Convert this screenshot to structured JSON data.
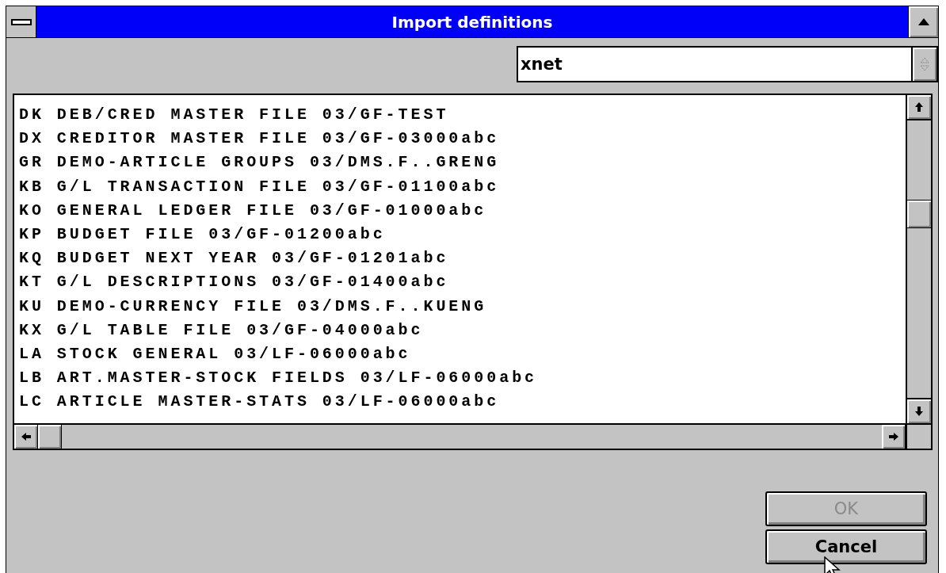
{
  "window": {
    "title": "Import definitions"
  },
  "source_combo": {
    "value": "xnet"
  },
  "definitions": [
    {
      "text": "DK DEB/CRED MASTER FILE 03/GF-TEST",
      "selected": false
    },
    {
      "text": "DX CREDITOR MASTER FILE 03/GF-03000abc",
      "selected": false
    },
    {
      "text": "GR DEMO-ARTICLE GROUPS 03/DMS.F..GRENG",
      "selected": false
    },
    {
      "text": "KB G/L TRANSACTION FILE 03/GF-01100abc",
      "selected": false
    },
    {
      "text": "KO GENERAL LEDGER FILE 03/GF-01000abc",
      "selected": false
    },
    {
      "text": "KP BUDGET FILE 03/GF-01200abc",
      "selected": false
    },
    {
      "text": "KQ BUDGET NEXT YEAR 03/GF-01201abc",
      "selected": false
    },
    {
      "text": "KT G/L DESCRIPTIONS 03/GF-01400abc",
      "selected": false
    },
    {
      "text": "KU DEMO-CURRENCY FILE 03/DMS.F..KUENG",
      "selected": false
    },
    {
      "text": "KX G/L TABLE FILE 03/GF-04000abc",
      "selected": false
    },
    {
      "text": "LA STOCK GENERAL 03/LF-06000abc",
      "selected": false
    },
    {
      "text": "LB ART.MASTER-STOCK FIELDS 03/LF-06000abc",
      "selected": false
    },
    {
      "text": "LC ARTICLE MASTER-STATS 03/LF-06000abc",
      "selected": false
    }
  ],
  "buttons": [
    {
      "label": "OK",
      "disabled": true
    },
    {
      "label": "Cancel",
      "disabled": false
    }
  ]
}
